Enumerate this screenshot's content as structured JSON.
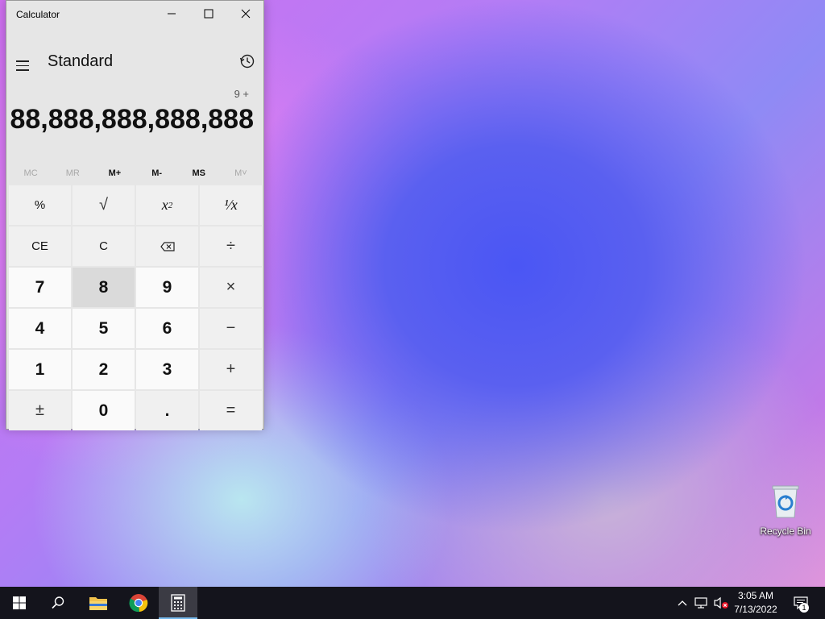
{
  "window": {
    "title": "Calculator",
    "mode": "Standard",
    "expression": "9 +",
    "display": "88,888,888,888,888"
  },
  "memory": [
    {
      "label": "MC",
      "enabled": false
    },
    {
      "label": "MR",
      "enabled": false
    },
    {
      "label": "M+",
      "enabled": true
    },
    {
      "label": "M-",
      "enabled": true
    },
    {
      "label": "MS",
      "enabled": true
    },
    {
      "label": "M˅",
      "enabled": false
    }
  ],
  "keys": {
    "percent": "%",
    "sqrt": "√",
    "square_base": "x",
    "square_exp": "2",
    "reciprocal": "¹⁄x",
    "ce": "CE",
    "c": "C",
    "divide": "÷",
    "seven": "7",
    "eight": "8",
    "nine": "9",
    "multiply": "×",
    "four": "4",
    "five": "5",
    "six": "6",
    "minus": "−",
    "one": "1",
    "two": "2",
    "three": "3",
    "plus": "+",
    "negate": "±",
    "zero": "0",
    "decimal": ".",
    "equals": "="
  },
  "desktop": {
    "recycle_bin_label": "Recycle Bin"
  },
  "taskbar": {
    "time": "3:05 AM",
    "date": "7/13/2022",
    "notification_count": "1",
    "pinned": [
      "start-icon",
      "search-icon",
      "file-explorer-icon",
      "chrome-icon",
      "calculator-icon"
    ]
  },
  "colors": {
    "taskbar_bg": "#14141c",
    "accent": "#76b9ed",
    "calc_bg": "#e6e6e6"
  }
}
